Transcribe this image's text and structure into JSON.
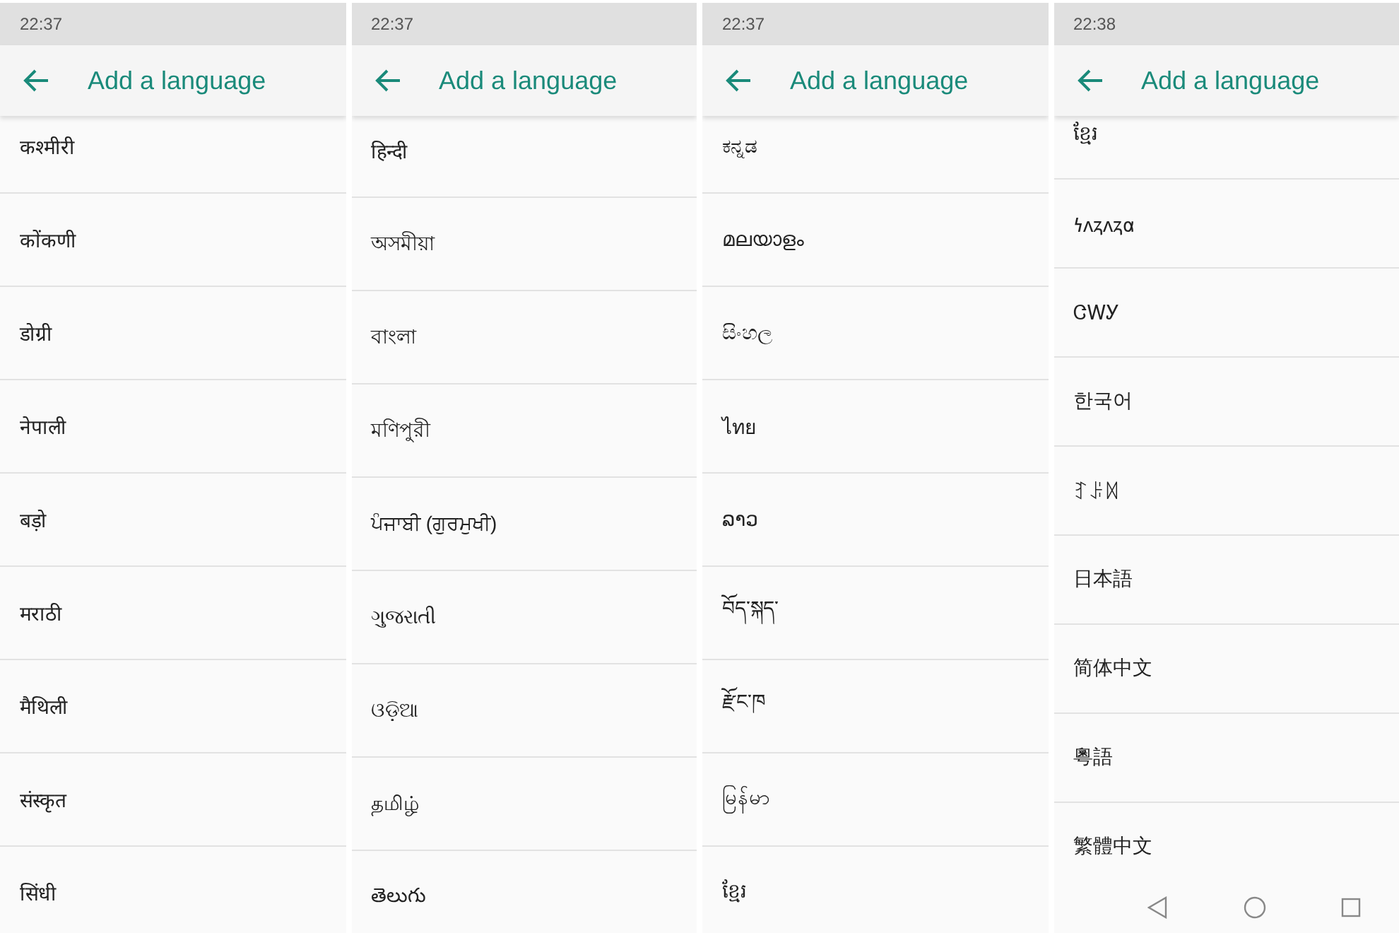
{
  "panels": [
    {
      "time": "22:37",
      "title": "Add a language",
      "navigation_bar": false,
      "items": [
        "कश्मीरी",
        "कोंकणी",
        "डोग्री",
        "नेपाली",
        "बड़ो",
        "मराठी",
        "मैथिली",
        "संस्कृत",
        "सिंधी"
      ]
    },
    {
      "time": "22:37",
      "title": "Add a language",
      "navigation_bar": false,
      "items": [
        "हिन्दी",
        "অসমীয়া",
        "বাংলা",
        "মণিপুরী",
        "ਪੰਜਾਬੀ (ਗੁਰਮੁਖੀ)",
        "ગુજરાતી",
        "ଓଡ଼ିଆ",
        "தமிழ்",
        "తెలుగు"
      ]
    },
    {
      "time": "22:37",
      "title": "Add a language",
      "navigation_bar": false,
      "items": [
        "ಕನ್ನಡ",
        "മലയാളം",
        "සිංහල",
        "ไทย",
        "ລາວ",
        "བོད་སྐད་",
        "རྫོང་ཁ",
        "မြန်မာ",
        "ខ្មែរ"
      ]
    },
    {
      "time": "22:38",
      "title": "Add a language",
      "navigation_bar": true,
      "items": [
        "ខ្មែរ",
        "𐓏𐓘𐓻𐓘𐓻𐓟",
        "ᏣᎳᎩ",
        "한국어",
        "ꆈꌠꉙ",
        "日本語",
        "简体中文",
        "粵語",
        "繁體中文"
      ]
    }
  ]
}
